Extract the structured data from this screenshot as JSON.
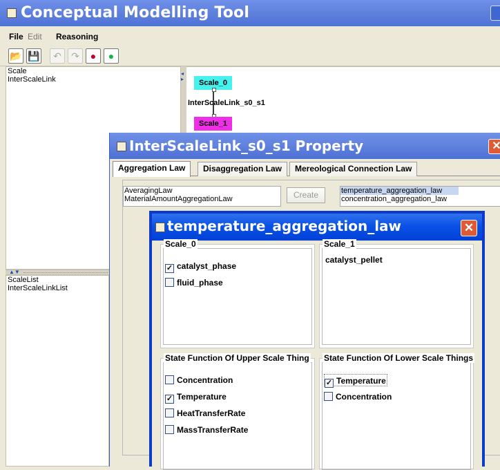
{
  "app": {
    "title": "Conceptual Modelling Tool"
  },
  "menu": {
    "file": "File",
    "edit": "Edit",
    "reasoning": "Reasoning"
  },
  "toolbar": {
    "icons": [
      "open-folder-icon",
      "save-icon",
      "undo-icon",
      "redo-icon",
      "red-dot-icon",
      "green-dot-icon"
    ]
  },
  "left_top_list": [
    "Scale",
    "InterScaleLink"
  ],
  "left_bottom_list": [
    "ScaleList",
    "InterScaleLinkList"
  ],
  "canvas": {
    "scale0": "Scale_0",
    "link": "InterScaleLink_s0_s1",
    "scale1": "Scale_1"
  },
  "property_dialog": {
    "title": "InterScaleLink_s0_s1 Property",
    "tabs": [
      "Aggregation Law",
      "Disaggregation Law",
      "Mereological Connection Law"
    ],
    "law_options": [
      "AveragingLaw",
      "MaterialAmountAggregationLaw"
    ],
    "create_label": "Create",
    "results": [
      "temperature_aggregation_law",
      "concentration_aggregation_law"
    ]
  },
  "law_dialog": {
    "title": "temperature_aggregation_law",
    "scale0": {
      "label": "Scale_0",
      "items": [
        {
          "label": "catalyst_phase",
          "checked": true
        },
        {
          "label": "fluid_phase",
          "checked": false
        }
      ]
    },
    "scale1": {
      "label": "Scale_1",
      "value": "catalyst_pellet"
    },
    "upper": {
      "label": "State Function Of Upper Scale Thing",
      "items": [
        {
          "label": "Concentration",
          "checked": false
        },
        {
          "label": "Temperature",
          "checked": true
        },
        {
          "label": "HeatTransferRate",
          "checked": false
        },
        {
          "label": "MassTransferRate",
          "checked": false
        }
      ]
    },
    "lower": {
      "label": "State Function Of Lower Scale Things",
      "items": [
        {
          "label": "Temperature",
          "checked": true
        },
        {
          "label": "Concentration",
          "checked": false
        }
      ]
    }
  },
  "colors": {
    "scale0_node": "#45f2ee",
    "scale1_node": "#ef2ee7",
    "close_button": "#de5b35",
    "title_blue": "#0b52e6"
  }
}
